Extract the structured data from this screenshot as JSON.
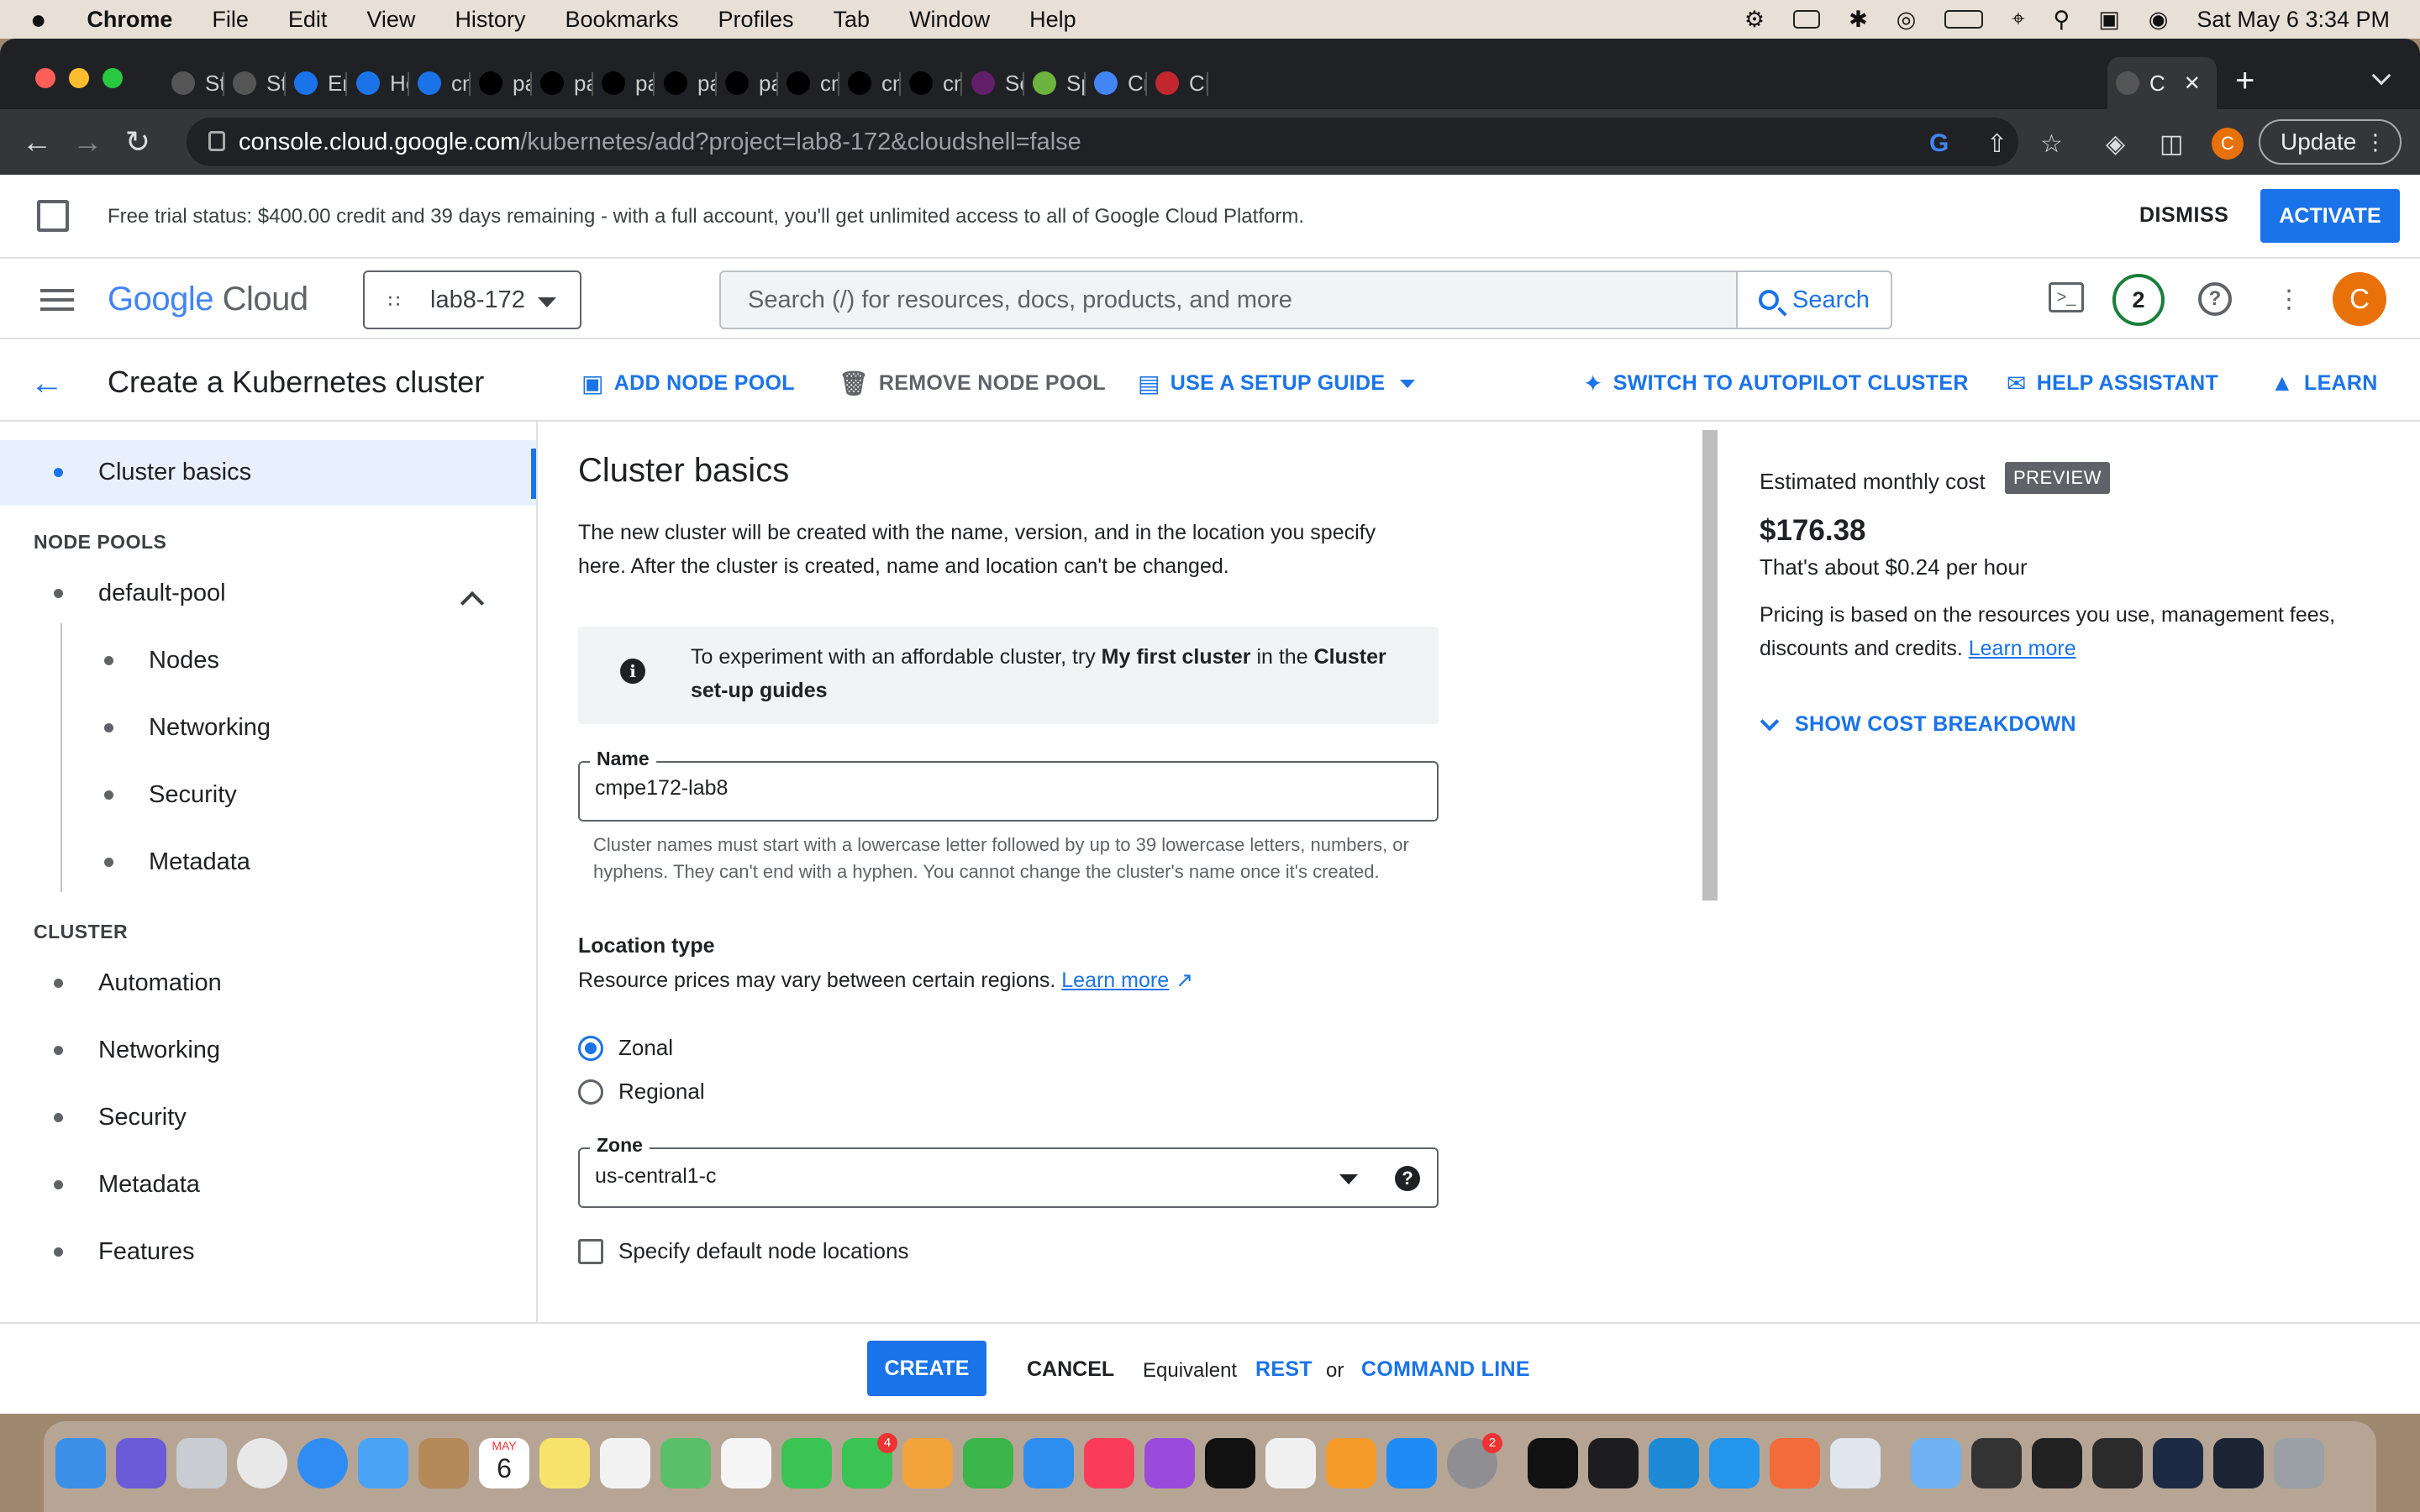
{
  "menubar": {
    "apple": "",
    "app": "Chrome",
    "items": [
      "File",
      "Edit",
      "View",
      "History",
      "Bookmarks",
      "Profiles",
      "Tab",
      "Window",
      "Help"
    ],
    "datetime": "Sat May 6  3:34 PM"
  },
  "tabs": [
    {
      "label": "Starb",
      "icon": "globe-icon"
    },
    {
      "label": "Stati",
      "icon": "globe-icon"
    },
    {
      "label": "Enter",
      "icon": "loading-icon"
    },
    {
      "label": "Hello",
      "icon": "loading-icon"
    },
    {
      "label": "cmpe",
      "icon": "loading-icon"
    },
    {
      "label": "pauln",
      "icon": "github-icon"
    },
    {
      "label": "pauln",
      "icon": "github-icon"
    },
    {
      "label": "pauln",
      "icon": "github-icon"
    },
    {
      "label": "pauln",
      "icon": "github-icon"
    },
    {
      "label": "pauln",
      "icon": "github-icon"
    },
    {
      "label": "cmpe",
      "icon": "github-icon"
    },
    {
      "label": "cmpe",
      "icon": "github-icon"
    },
    {
      "label": "cmpe",
      "icon": "github-icon"
    },
    {
      "label": "Searc",
      "icon": "slack-icon"
    },
    {
      "label": "Sprin",
      "icon": "spring-icon"
    },
    {
      "label": "Cred",
      "icon": "location-icon"
    },
    {
      "label": "CMP",
      "icon": "gear-icon"
    },
    {
      "label": "C",
      "icon": "gke-icon"
    }
  ],
  "browser": {
    "url_host": "console.cloud.google.com",
    "url_path": "/kubernetes/add?project=lab8-172&cloudshell=false",
    "profile_initial": "C",
    "update_label": "Update"
  },
  "trial": {
    "text": "Free trial status: $400.00 credit and 39 days remaining - with a full account, you'll get unlimited access to all of Google Cloud Platform.",
    "dismiss": "DISMISS",
    "activate": "ACTIVATE"
  },
  "header": {
    "logo_google": "Google",
    "logo_cloud": "Cloud",
    "project": "lab8-172",
    "search_placeholder": "Search (/) for resources, docs, products, and more",
    "search_button": "Search",
    "notifications": "2",
    "avatar": "C"
  },
  "titlebar": {
    "title": "Create a Kubernetes cluster",
    "actions": {
      "add_node_pool": "ADD NODE POOL",
      "remove_node_pool": "REMOVE NODE POOL",
      "setup_guide": "USE A SETUP GUIDE",
      "autopilot": "SWITCH TO AUTOPILOT CLUSTER",
      "help": "HELP ASSISTANT",
      "learn": "LEARN"
    }
  },
  "leftnav": {
    "cluster_basics": "Cluster basics",
    "node_pools_header": "NODE POOLS",
    "default_pool": "default-pool",
    "pool_items": [
      "Nodes",
      "Networking",
      "Security",
      "Metadata"
    ],
    "cluster_header": "CLUSTER",
    "cluster_items": [
      "Automation",
      "Networking",
      "Security",
      "Metadata",
      "Features"
    ]
  },
  "form": {
    "heading": "Cluster basics",
    "description": "The new cluster will be created with the name, version, and in the location you specify here. After the cluster is created, name and location can't be changed.",
    "info_pre": "To experiment with an affordable cluster, try ",
    "info_bold1": "My first cluster",
    "info_mid": " in the ",
    "info_bold2": "Cluster set-up guides",
    "name_label": "Name",
    "name_value": "cmpe172-lab8",
    "name_hint": "Cluster names must start with a lowercase letter followed by up to 39 lowercase letters, numbers, or hyphens. They can't end with a hyphen. You cannot change the cluster's name once it's created.",
    "location_type": "Location type",
    "location_text": "Resource prices may vary between certain regions. ",
    "learn_more": "Learn more",
    "zonal": "Zonal",
    "regional": "Regional",
    "zone_label": "Zone",
    "zone_value": "us-central1-c",
    "specify_default": "Specify default node locations"
  },
  "cost": {
    "heading": "Estimated monthly cost",
    "badge": "PREVIEW",
    "price": "$176.38",
    "per_hour": "That's about $0.24 per hour",
    "note": "Pricing is based on the resources you use, management fees, discounts and credits. ",
    "learn_more": "Learn more",
    "breakdown": "SHOW COST BREAKDOWN"
  },
  "footer": {
    "create": "CREATE",
    "cancel": "CANCEL",
    "equivalent": "Equivalent",
    "rest": "REST",
    "or": "or",
    "command_line": "COMMAND LINE"
  },
  "dock": {
    "calendar_month": "MAY",
    "calendar_day": "6",
    "facetime_badge": "4",
    "settings_badge": "2"
  }
}
